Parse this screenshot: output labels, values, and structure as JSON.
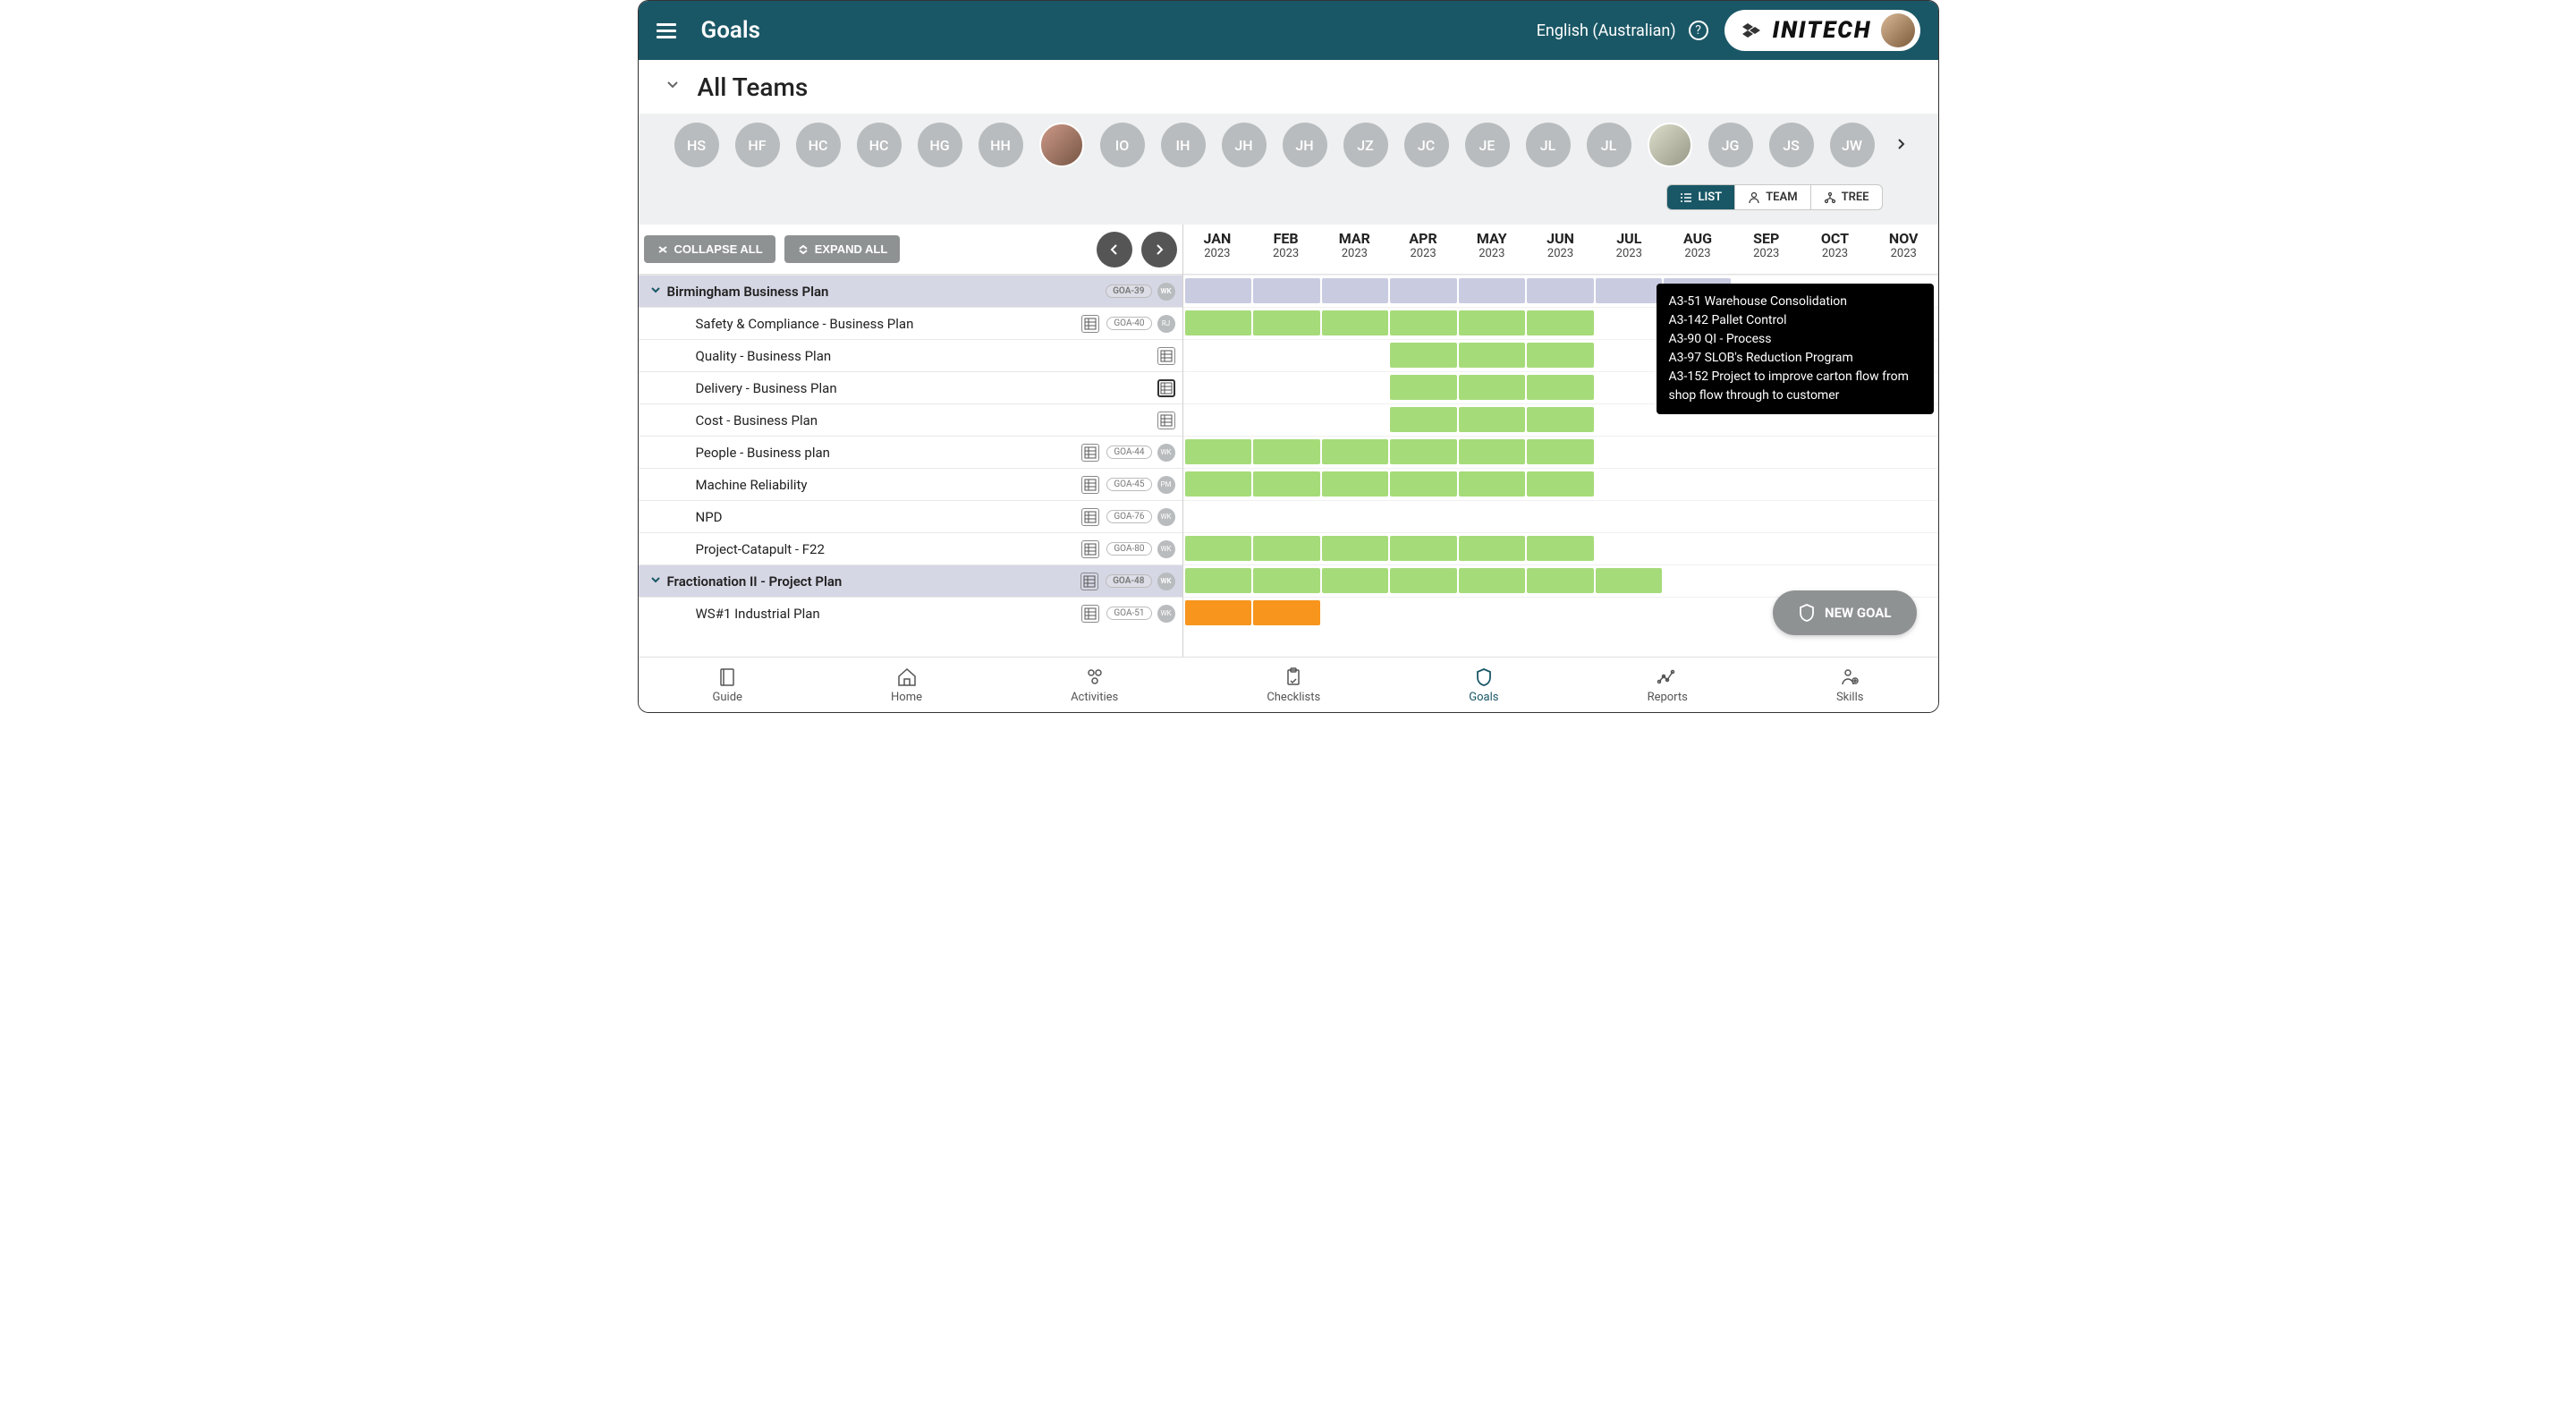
{
  "header": {
    "title": "Goals",
    "language": "English (Australian)",
    "brand": "INITECH"
  },
  "subheader": {
    "title": "All Teams"
  },
  "avatars": [
    "HS",
    "HF",
    "HC",
    "HC",
    "HG",
    "HH",
    "",
    "IO",
    "IH",
    "JH",
    "JH",
    "JZ",
    "JC",
    "JE",
    "JL",
    "JL",
    "",
    "JG",
    "JS",
    "JW"
  ],
  "viewToggle": {
    "list": "LIST",
    "team": "TEAM",
    "tree": "TREE",
    "active": "list"
  },
  "toolbar": {
    "collapse": "COLLAPSE ALL",
    "expand": "EXPAND ALL"
  },
  "months": [
    {
      "m": "JAN",
      "y": "2023"
    },
    {
      "m": "FEB",
      "y": "2023"
    },
    {
      "m": "MAR",
      "y": "2023"
    },
    {
      "m": "APR",
      "y": "2023"
    },
    {
      "m": "MAY",
      "y": "2023"
    },
    {
      "m": "JUN",
      "y": "2023"
    },
    {
      "m": "JUL",
      "y": "2023"
    },
    {
      "m": "AUG",
      "y": "2023"
    },
    {
      "m": "SEP",
      "y": "2023"
    },
    {
      "m": "OCT",
      "y": "2023"
    },
    {
      "m": "NOV",
      "y": "2023"
    }
  ],
  "rows": [
    {
      "type": "group",
      "name": "Birmingham Business Plan",
      "tag": "GOA-39",
      "mini": "WK",
      "segs": [
        "purple",
        "purple",
        "purple",
        "purple",
        "purple",
        "purple",
        "purple",
        "purple",
        "",
        "",
        ""
      ]
    },
    {
      "type": "child",
      "name": "Safety & Compliance - Business Plan",
      "tag": "GOA-40",
      "mini": "RJ",
      "segs": [
        "green",
        "green",
        "green",
        "green",
        "green",
        "green",
        "",
        "",
        "",
        "",
        ""
      ]
    },
    {
      "type": "child",
      "name": "Quality - Business Plan",
      "tag": "",
      "mini": "",
      "segs": [
        "",
        "",
        "",
        "green",
        "green",
        "green",
        "",
        "",
        "",
        "",
        ""
      ]
    },
    {
      "type": "child",
      "name": "Delivery - Business Plan",
      "tag": "",
      "mini": "",
      "hover": true,
      "segs": [
        "",
        "",
        "",
        "green",
        "green",
        "green",
        "",
        "",
        "",
        "",
        ""
      ]
    },
    {
      "type": "child",
      "name": "Cost - Business Plan",
      "tag": "",
      "mini": "",
      "segs": [
        "",
        "",
        "",
        "green",
        "green",
        "green",
        "",
        "",
        "",
        "",
        ""
      ]
    },
    {
      "type": "child",
      "name": "People - Business plan",
      "tag": "GOA-44",
      "mini": "WK",
      "segs": [
        "green",
        "green",
        "green",
        "green",
        "green",
        "green",
        "",
        "",
        "",
        "",
        ""
      ]
    },
    {
      "type": "child",
      "name": "Machine Reliability",
      "tag": "GOA-45",
      "mini": "PM",
      "segs": [
        "green",
        "green",
        "green",
        "green",
        "green",
        "green",
        "",
        "",
        "",
        "",
        ""
      ]
    },
    {
      "type": "child",
      "name": "NPD",
      "tag": "GOA-76",
      "mini": "WK",
      "segs": [
        "",
        "",
        "",
        "",
        "",
        "",
        "",
        "",
        "",
        "",
        ""
      ]
    },
    {
      "type": "child",
      "name": "Project-Catapult - F22",
      "tag": "GOA-80",
      "mini": "WK",
      "segs": [
        "green",
        "green",
        "green",
        "green",
        "green",
        "green",
        "",
        "",
        "",
        "",
        ""
      ]
    },
    {
      "type": "group",
      "name": "Fractionation II - Project Plan",
      "tag": "GOA-48",
      "mini": "WK",
      "hasGrid": true,
      "segs": [
        "green",
        "green",
        "green",
        "green",
        "green",
        "green",
        "green",
        "",
        "",
        "",
        ""
      ]
    },
    {
      "type": "child",
      "name": "WS#1 Industrial Plan",
      "tag": "GOA-51",
      "mini": "WK",
      "segs": [
        "orange",
        "orange",
        "",
        "",
        "",
        "",
        "",
        "",
        "",
        "",
        ""
      ]
    }
  ],
  "tooltip": [
    "A3-51 Warehouse Consolidation",
    "A3-142 Pallet Control",
    "A3-90 QI - Process",
    "A3-97 SLOB's Reduction Program",
    "A3-152 Project to improve carton flow from shop flow through to customer"
  ],
  "fab": "NEW GOAL",
  "nav": [
    {
      "label": "Guide",
      "active": false
    },
    {
      "label": "Home",
      "active": false
    },
    {
      "label": "Activities",
      "active": false
    },
    {
      "label": "Checklists",
      "active": false
    },
    {
      "label": "Goals",
      "active": true
    },
    {
      "label": "Reports",
      "active": false
    },
    {
      "label": "Skills",
      "active": false
    }
  ]
}
